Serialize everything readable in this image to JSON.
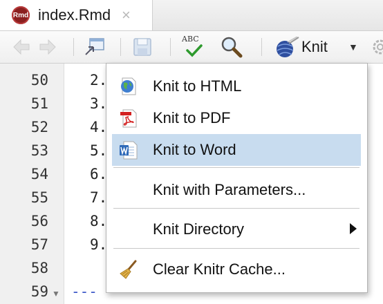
{
  "tab": {
    "file_badge": "Rmd",
    "title": "index.Rmd",
    "close_glyph": "×"
  },
  "toolbar": {
    "knit_label": "Knit",
    "spell_label": "ABC",
    "icons": [
      "back-arrow-icon",
      "forward-arrow-icon",
      "show-in-window-icon",
      "save-icon",
      "spellcheck-icon",
      "search-icon",
      "knit-yarn-icon",
      "chevron-down-icon",
      "gear-icon"
    ]
  },
  "editor": {
    "line_numbers": [
      "50",
      "51",
      "52",
      "53",
      "54",
      "55",
      "56",
      "57",
      "58",
      "59"
    ],
    "code_lines": [
      "2.",
      "3.",
      "4.",
      "5.",
      "6.",
      "7.",
      "8.",
      "9.",
      "",
      "---"
    ]
  },
  "menu": {
    "items": [
      {
        "label": "Knit to HTML",
        "icon": "globe-icon"
      },
      {
        "label": "Knit to PDF",
        "icon": "pdf-icon"
      },
      {
        "label": "Knit to Word",
        "icon": "word-icon",
        "selected": true
      },
      {
        "label": "Knit with Parameters..."
      },
      {
        "label": "Knit Directory",
        "submenu": true
      },
      {
        "label": "Clear Knitr Cache...",
        "icon": "broom-icon"
      }
    ],
    "selected_color": "#c8dcef"
  }
}
